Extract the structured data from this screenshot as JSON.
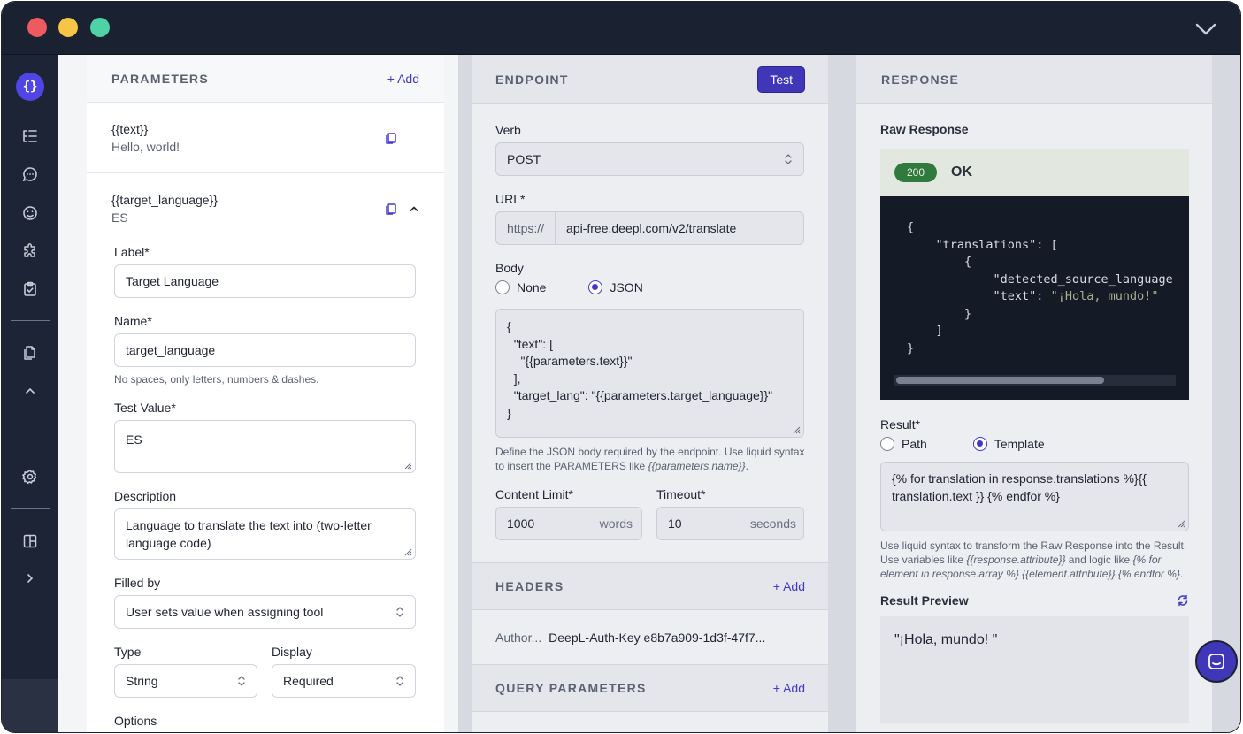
{
  "parameters": {
    "title": "PARAMETERS",
    "add_label": "+ Add",
    "items": [
      {
        "name": "{{text}}",
        "value": "Hello, world!"
      },
      {
        "name": "{{target_language}}",
        "value": "ES"
      }
    ],
    "form": {
      "label_label": "Label*",
      "label_value": "Target Language",
      "name_label": "Name*",
      "name_value": "target_language",
      "name_help": "No spaces, only letters, numbers & dashes.",
      "test_value_label": "Test Value*",
      "test_value_value": "ES",
      "description_label": "Description",
      "description_value": "Language to translate the text into (two-letter language code)",
      "filled_by_label": "Filled by",
      "filled_by_value": "User sets value when assigning tool",
      "type_label": "Type",
      "type_value": "String",
      "display_label": "Display",
      "display_value": "Required",
      "options_label": "Options"
    }
  },
  "endpoint": {
    "title": "ENDPOINT",
    "test_label": "Test",
    "verb_label": "Verb",
    "verb_value": "POST",
    "url_label": "URL*",
    "url_prefix": "https://",
    "url_value": "api-free.deepl.com/v2/translate",
    "body_label": "Body",
    "body_none": "None",
    "body_json": "JSON",
    "body_value": "{\n  \"text\": [\n    \"{{parameters.text}}\"\n  ],\n  \"target_lang\": \"{{parameters.target_language}}\"\n}",
    "body_help_1": "Define the JSON body required by the endpoint. Use liquid syntax to insert the PARAMETERS like ",
    "body_help_code": "{{parameters.name}}",
    "body_help_end": ".",
    "content_limit_label": "Content Limit*",
    "content_limit_value": "1000",
    "content_limit_unit": "words",
    "timeout_label": "Timeout*",
    "timeout_value": "10",
    "timeout_unit": "seconds"
  },
  "headers": {
    "title": "HEADERS",
    "add_label": "+ Add",
    "row_key": "Author...",
    "row_value": "DeepL-Auth-Key e8b7a909-1d3f-47f7..."
  },
  "query_parameters": {
    "title": "QUERY PARAMETERS",
    "add_label": "+ Add"
  },
  "response": {
    "title": "RESPONSE",
    "raw_label": "Raw Response",
    "status_code": "200",
    "status_text": "OK",
    "raw_lines": [
      "{",
      "    \"translations\": [",
      "        {",
      "            \"detected_source_language",
      "            \"text\": ",
      "        }",
      "    ]",
      "}"
    ],
    "raw_text_value": "\"¡Hola, mundo!\"",
    "result_label": "Result*",
    "result_path": "Path",
    "result_template": "Template",
    "result_value": "{% for translation in response.translations %}{{ translation.text }} {% endfor %}",
    "result_help_1": "Use liquid syntax to transform the Raw Response into the Result. Use variables like ",
    "result_help_code_1": "{{response.attribute}}",
    "result_help_2": " and logic like ",
    "result_help_code_2": "{% for element in response.array %} {{element.attribute}} {% endfor %}",
    "result_help_end": ".",
    "preview_label": "Result Preview",
    "preview_value": "\"¡Hola, mundo! \""
  }
}
